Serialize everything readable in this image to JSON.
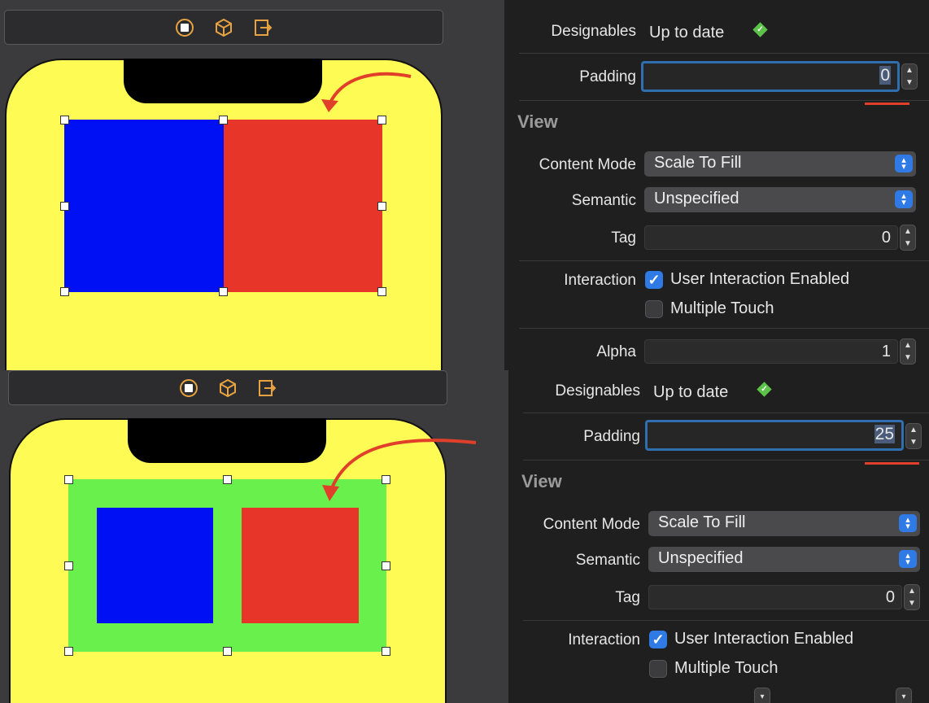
{
  "colors": {
    "phone_bg": "#fffb55",
    "blue_view": "#0010f5",
    "red_view": "#e8352a",
    "green_container": "#6af04c",
    "annotation_arrow": "#e0402a",
    "accent": "#2f7ae5"
  },
  "toolbar_icons": [
    "stop-icon",
    "cube-icon",
    "exit-icon"
  ],
  "panels": [
    {
      "padding_value": 0,
      "inspector": {
        "designables_label": "Designables",
        "designables_value": "Up to date",
        "padding_label": "Padding",
        "padding_value": "0",
        "view_section": "View",
        "content_mode_label": "Content Mode",
        "content_mode_value": "Scale To Fill",
        "semantic_label": "Semantic",
        "semantic_value": "Unspecified",
        "tag_label": "Tag",
        "tag_value": "0",
        "interaction_label": "Interaction",
        "user_interaction_label": "User Interaction Enabled",
        "multiple_touch_label": "Multiple Touch",
        "alpha_label": "Alpha",
        "alpha_value": "1"
      }
    },
    {
      "padding_value": 25,
      "inspector": {
        "designables_label": "Designables",
        "designables_value": "Up to date",
        "padding_label": "Padding",
        "padding_value": "25",
        "view_section": "View",
        "content_mode_label": "Content Mode",
        "content_mode_value": "Scale To Fill",
        "semantic_label": "Semantic",
        "semantic_value": "Unspecified",
        "tag_label": "Tag",
        "tag_value": "0",
        "interaction_label": "Interaction",
        "user_interaction_label": "User Interaction Enabled",
        "multiple_touch_label": "Multiple Touch"
      }
    }
  ]
}
